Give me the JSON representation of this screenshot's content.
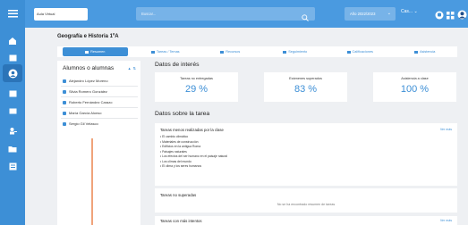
{
  "sidebar": {
    "icons": [
      "menu-icon",
      "home-icon",
      "calendar-icon",
      "person-icon",
      "inbox-icon",
      "chat-icon",
      "user-add-icon",
      "folder-icon",
      "grid-icon"
    ]
  },
  "topbar": {
    "logo_text": "Aula Virtual",
    "search_placeholder": "Buscar...",
    "year": "Año 2022/2023",
    "user": "Cas..."
  },
  "course_title": "Geografía e Historia 1ºA",
  "tabs": [
    {
      "label": "Resumen",
      "active": true
    },
    {
      "label": "Tareas / Temas",
      "active": false
    },
    {
      "label": "Recursos",
      "active": false
    },
    {
      "label": "Seguimiento",
      "active": false
    },
    {
      "label": "Calificaciones",
      "active": false
    },
    {
      "label": "Asistencia",
      "active": false
    }
  ],
  "students": {
    "title": "Alumnos o alumnas",
    "list": [
      "Alejandro López Moreno",
      "Silvia Romero González",
      "Roberto Fernández Carazo",
      "María García Alonso",
      "Sergio Gil Velasco"
    ]
  },
  "data_heading": "Datos de interés",
  "stats": [
    {
      "label": "Tareas no entregadas",
      "value": "29 %"
    },
    {
      "label": "Exámenes superados",
      "value": "83 %"
    },
    {
      "label": "Asistencia a clase",
      "value": "100 %"
    }
  ],
  "task_heading": "Datos sobre la tarea",
  "less_done": {
    "title": "Tareas menos realizadas por la clase",
    "more": "Ver más",
    "items": [
      "• El cambio climático",
      "• Materiales de construcción",
      "• Edificios en la antigua Roma",
      "• Paisajes naturales",
      "• Los efectos del ser humano en el paisaje natural",
      "• Los climas del mundo",
      "• El clima y los seres humanos"
    ]
  },
  "failed": {
    "title": "Tareas no superadas",
    "empty": "No se ha encontrado resumen de tareas"
  },
  "attempts": {
    "title": "Tareas con más intentos",
    "more": "Ver más"
  },
  "colors": {
    "accent": "#3d8fd6",
    "topbar": "#4a9ae0",
    "timeline": "#f0a37a"
  }
}
